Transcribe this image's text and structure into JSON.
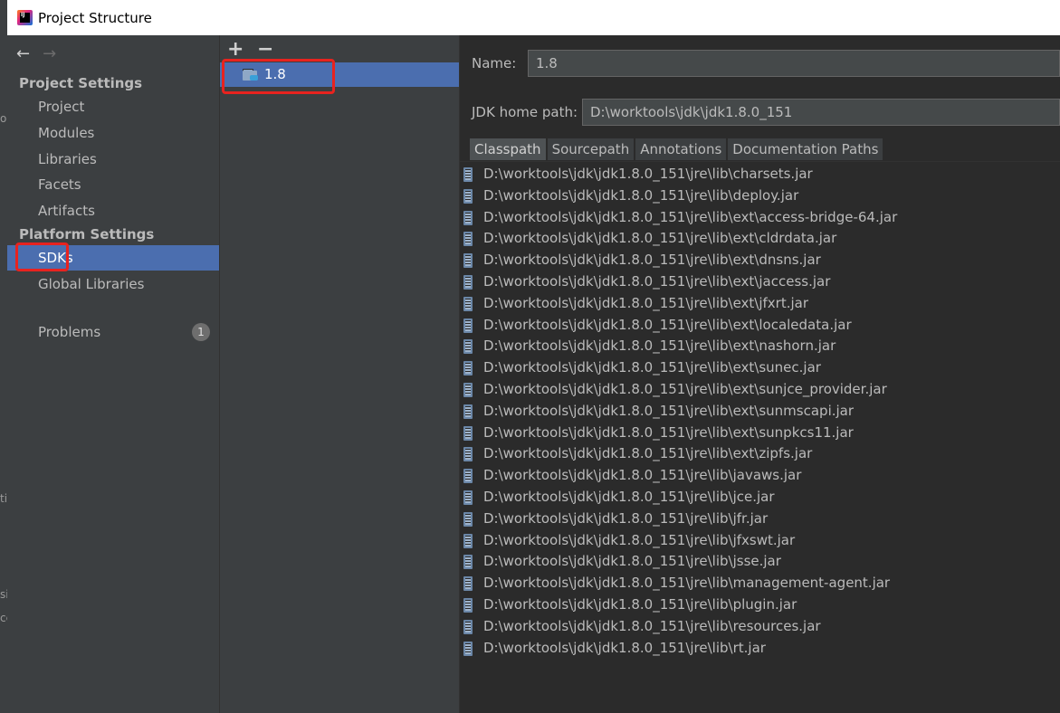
{
  "window": {
    "title": "Project Structure",
    "edge_fragments": [
      "on",
      "ti",
      "si",
      "ce"
    ]
  },
  "left_nav": {
    "back_label": "←",
    "forward_label": "→",
    "project_settings_title": "Project Settings",
    "project_items": [
      "Project",
      "Modules",
      "Libraries",
      "Facets",
      "Artifacts"
    ],
    "platform_settings_title": "Platform Settings",
    "platform_items": [
      "SDKs",
      "Global Libraries"
    ],
    "selected": "SDKs",
    "problems_label": "Problems",
    "problems_count": "1"
  },
  "sdk_list": {
    "add_label": "+",
    "remove_label": "−",
    "items": [
      "1.8"
    ],
    "selected": "1.8"
  },
  "sdk_detail": {
    "name_label": "Name:",
    "name_value": "1.8",
    "home_label": "JDK home path:",
    "home_value": "D:\\worktools\\jdk\\jdk1.8.0_151",
    "tabs": [
      "Classpath",
      "Sourcepath",
      "Annotations",
      "Documentation Paths"
    ],
    "active_tab": "Classpath",
    "classpath": [
      "D:\\worktools\\jdk\\jdk1.8.0_151\\jre\\lib\\charsets.jar",
      "D:\\worktools\\jdk\\jdk1.8.0_151\\jre\\lib\\deploy.jar",
      "D:\\worktools\\jdk\\jdk1.8.0_151\\jre\\lib\\ext\\access-bridge-64.jar",
      "D:\\worktools\\jdk\\jdk1.8.0_151\\jre\\lib\\ext\\cldrdata.jar",
      "D:\\worktools\\jdk\\jdk1.8.0_151\\jre\\lib\\ext\\dnsns.jar",
      "D:\\worktools\\jdk\\jdk1.8.0_151\\jre\\lib\\ext\\jaccess.jar",
      "D:\\worktools\\jdk\\jdk1.8.0_151\\jre\\lib\\ext\\jfxrt.jar",
      "D:\\worktools\\jdk\\jdk1.8.0_151\\jre\\lib\\ext\\localedata.jar",
      "D:\\worktools\\jdk\\jdk1.8.0_151\\jre\\lib\\ext\\nashorn.jar",
      "D:\\worktools\\jdk\\jdk1.8.0_151\\jre\\lib\\ext\\sunec.jar",
      "D:\\worktools\\jdk\\jdk1.8.0_151\\jre\\lib\\ext\\sunjce_provider.jar",
      "D:\\worktools\\jdk\\jdk1.8.0_151\\jre\\lib\\ext\\sunmscapi.jar",
      "D:\\worktools\\jdk\\jdk1.8.0_151\\jre\\lib\\ext\\sunpkcs11.jar",
      "D:\\worktools\\jdk\\jdk1.8.0_151\\jre\\lib\\ext\\zipfs.jar",
      "D:\\worktools\\jdk\\jdk1.8.0_151\\jre\\lib\\javaws.jar",
      "D:\\worktools\\jdk\\jdk1.8.0_151\\jre\\lib\\jce.jar",
      "D:\\worktools\\jdk\\jdk1.8.0_151\\jre\\lib\\jfr.jar",
      "D:\\worktools\\jdk\\jdk1.8.0_151\\jre\\lib\\jfxswt.jar",
      "D:\\worktools\\jdk\\jdk1.8.0_151\\jre\\lib\\jsse.jar",
      "D:\\worktools\\jdk\\jdk1.8.0_151\\jre\\lib\\management-agent.jar",
      "D:\\worktools\\jdk\\jdk1.8.0_151\\jre\\lib\\plugin.jar",
      "D:\\worktools\\jdk\\jdk1.8.0_151\\jre\\lib\\resources.jar",
      "D:\\worktools\\jdk\\jdk1.8.0_151\\jre\\lib\\rt.jar"
    ]
  },
  "colors": {
    "selection": "#4b6eaf",
    "highlight_box": "#e8231f",
    "panel_bg": "#3c3f41",
    "editor_bg": "#2b2b2b"
  }
}
